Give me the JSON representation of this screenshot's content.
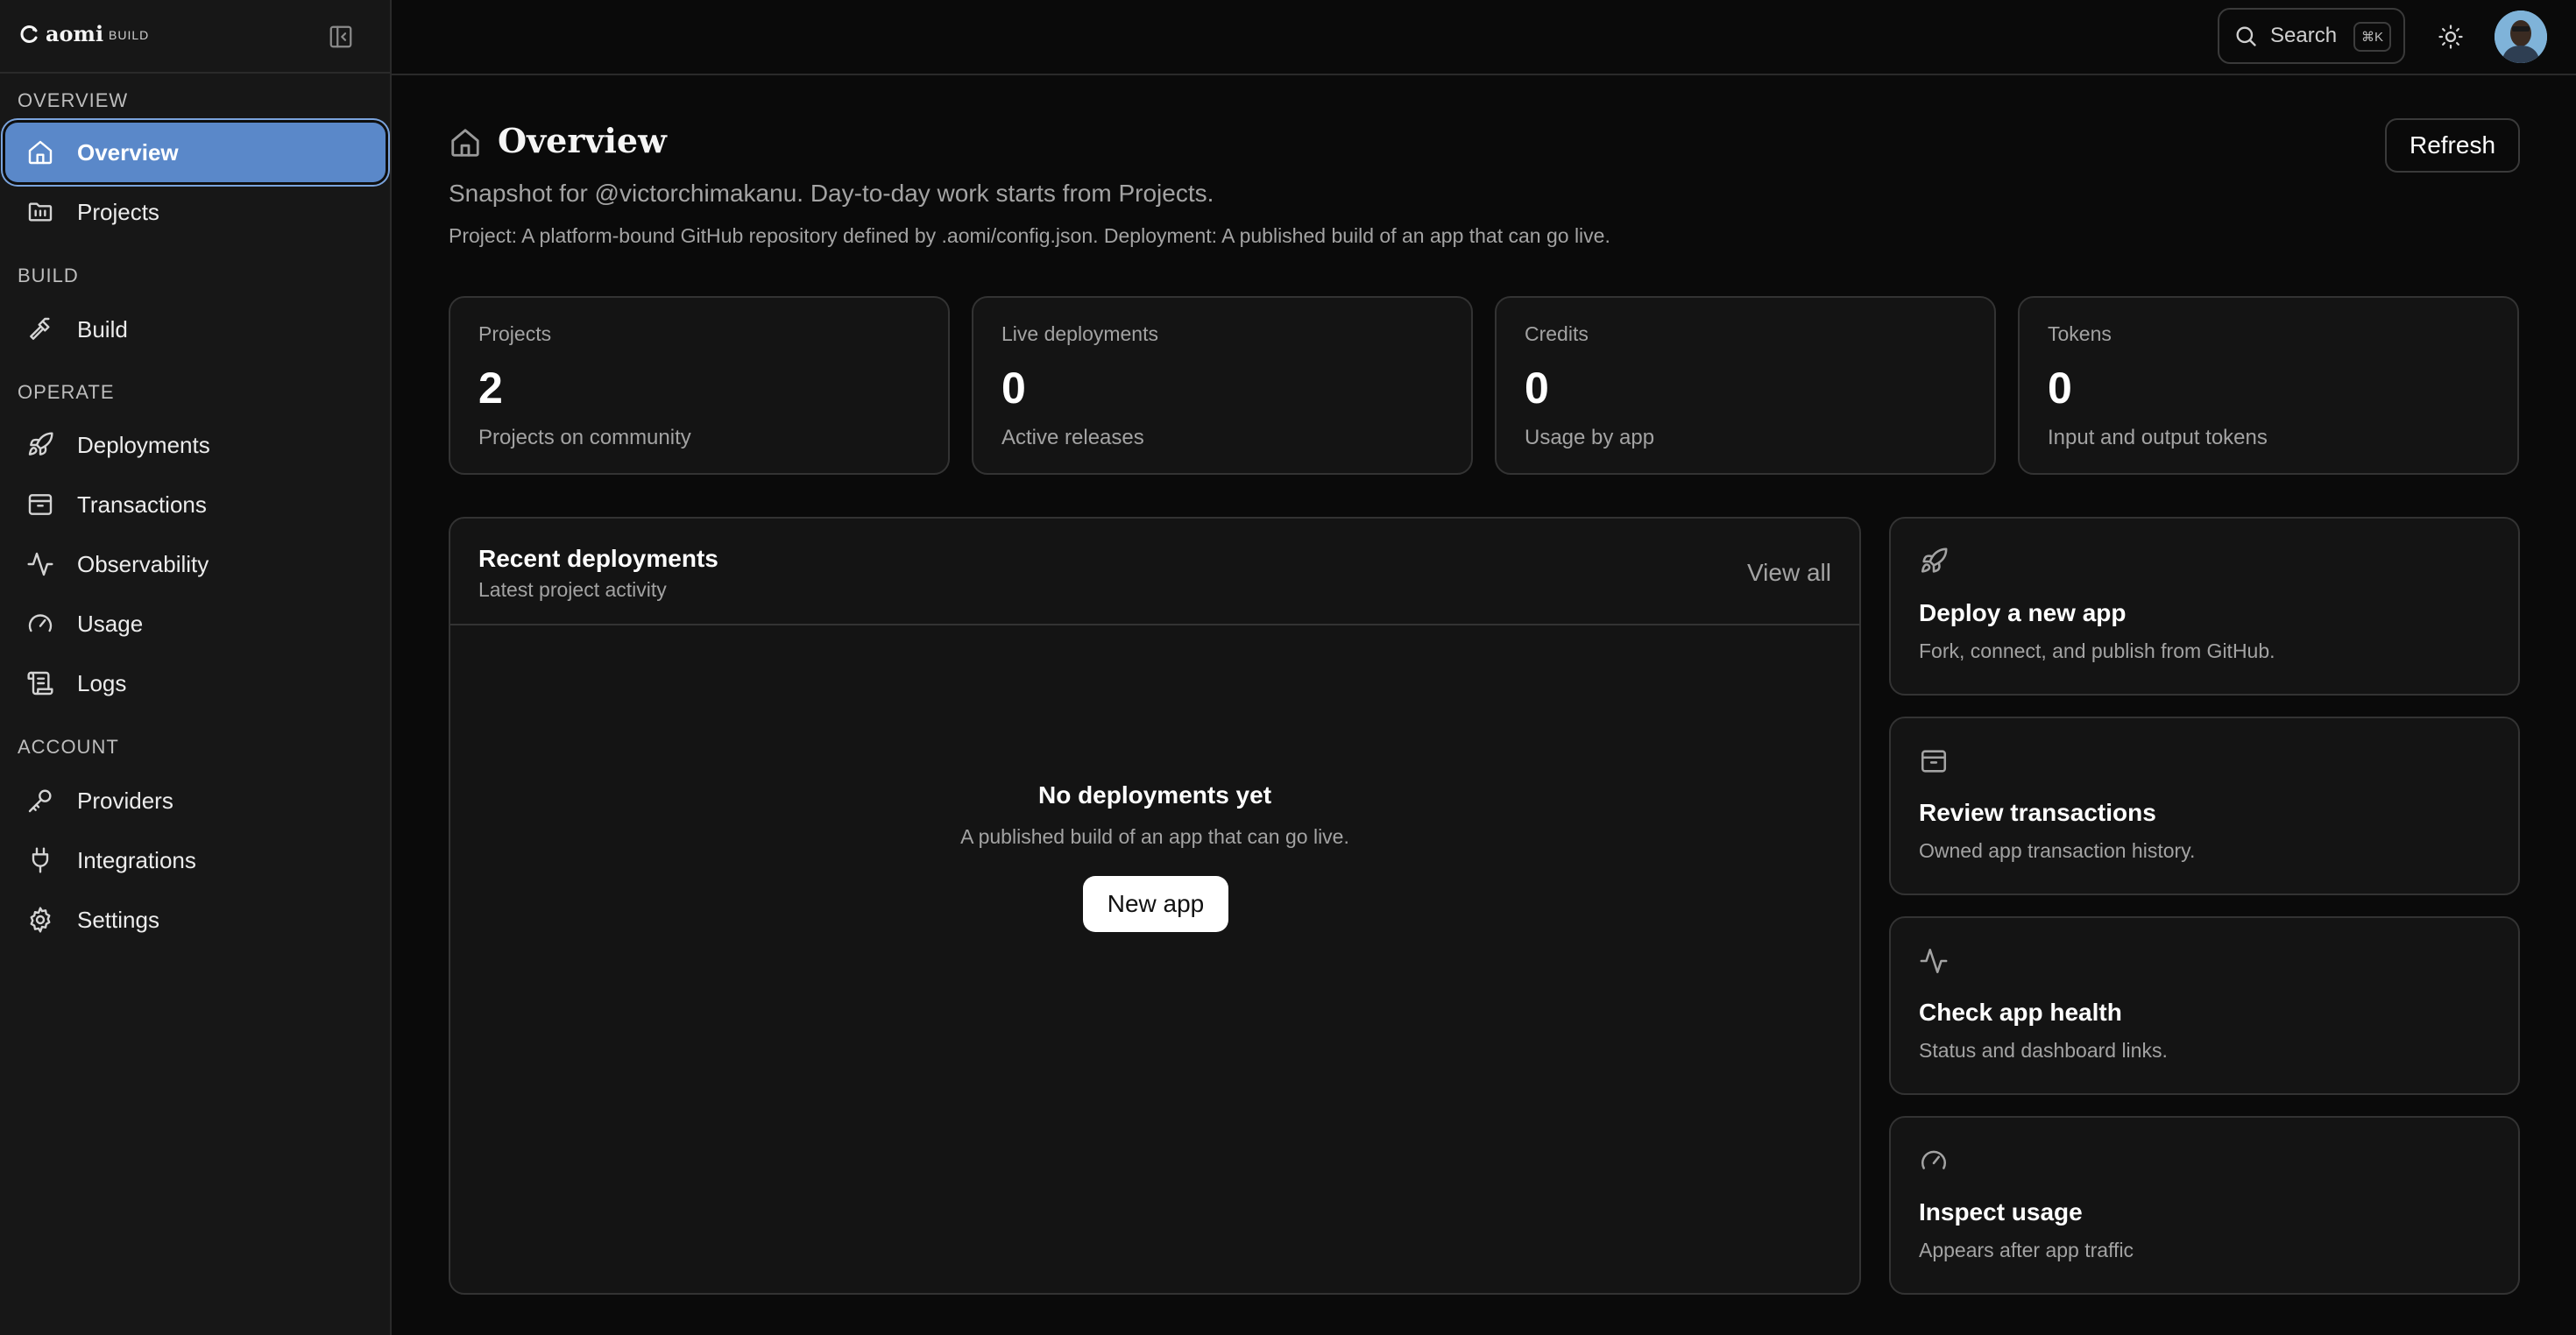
{
  "brand": {
    "name": "aomi",
    "badge": "BUILD"
  },
  "sidebar": {
    "sections": {
      "overview": "OVERVIEW",
      "build": "BUILD",
      "operate": "OPERATE",
      "account": "ACCOUNT"
    },
    "items": {
      "overview": "Overview",
      "projects": "Projects",
      "build": "Build",
      "deployments": "Deployments",
      "transactions": "Transactions",
      "observability": "Observability",
      "usage": "Usage",
      "logs": "Logs",
      "providers": "Providers",
      "integrations": "Integrations",
      "settings": "Settings"
    },
    "active": "overview"
  },
  "topbar": {
    "search_label": "Search",
    "search_shortcut": "⌘K"
  },
  "page": {
    "title": "Overview",
    "refresh_label": "Refresh",
    "subtitle": "Snapshot for @victorchimakanu. Day-to-day work starts from Projects.",
    "note": "Project: A platform-bound GitHub repository defined by .aomi/config.json. Deployment: A published build of an app that can go live."
  },
  "stats": [
    {
      "label": "Projects",
      "value": "2",
      "caption": "Projects on community"
    },
    {
      "label": "Live deployments",
      "value": "0",
      "caption": "Active releases"
    },
    {
      "label": "Credits",
      "value": "0",
      "caption": "Usage by app"
    },
    {
      "label": "Tokens",
      "value": "0",
      "caption": "Input and output tokens"
    }
  ],
  "recent_deployments": {
    "title": "Recent deployments",
    "subtitle": "Latest project activity",
    "view_all": "View all",
    "empty_title": "No deployments yet",
    "empty_subtitle": "A published build of an app that can go live.",
    "new_app_label": "New app"
  },
  "actions": [
    {
      "title": "Deploy a new app",
      "desc": "Fork, connect, and publish from GitHub.",
      "icon": "rocket-icon"
    },
    {
      "title": "Review transactions",
      "desc": "Owned app transaction history.",
      "icon": "archive-icon"
    },
    {
      "title": "Check app health",
      "desc": "Status and dashboard links.",
      "icon": "activity-icon"
    },
    {
      "title": "Inspect usage",
      "desc": "Appears after app traffic",
      "icon": "gauge-icon"
    }
  ],
  "colors": {
    "background": "#0a0a0a",
    "sidebar": "#171717",
    "active_item": "#5a88c9",
    "card": "#141414",
    "border": "#333333",
    "muted_text": "#a3a3a3"
  }
}
